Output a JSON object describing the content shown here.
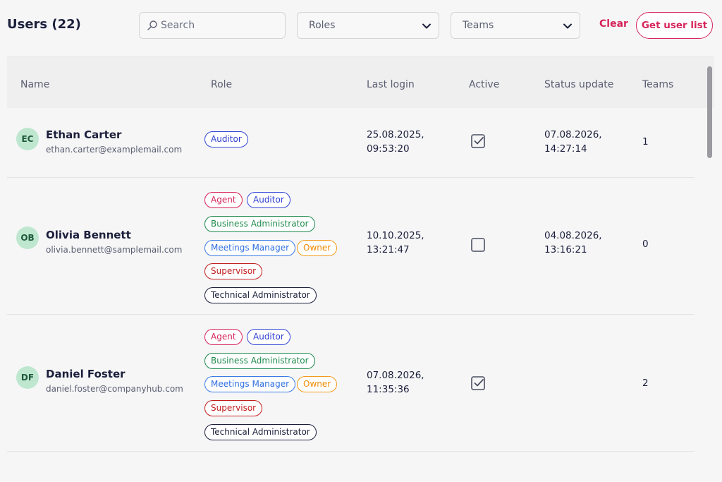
{
  "header": {
    "title": "Users (22)",
    "search_placeholder": "Search",
    "roles_filter": "Roles",
    "teams_filter": "Teams",
    "clear_label": "Clear",
    "get_list_label": "Get user list"
  },
  "table": {
    "columns": [
      "Name",
      "Role",
      "Last login",
      "Active",
      "Status update",
      "Teams"
    ],
    "rows": [
      {
        "initials": "EC",
        "name": "Ethan Carter",
        "email": "ethan.carter@examplemail.com",
        "roles": [
          "Auditor"
        ],
        "last_login_date": "25.08.2025,",
        "last_login_time": "09:53:20",
        "active": true,
        "status_date": "07.08.2026,",
        "status_time": "14:27:14",
        "teams": "1"
      },
      {
        "initials": "OB",
        "name": "Olivia Bennett",
        "email": "olivia.bennett@samplemail.com",
        "roles": [
          "Agent",
          "Auditor",
          "Business Administrator",
          "Meetings Manager",
          "Owner",
          "Supervisor",
          "Technical Administrator"
        ],
        "last_login_date": "10.10.2025,",
        "last_login_time": "13:21:47",
        "active": false,
        "status_date": "04.08.2026,",
        "status_time": "13:16:21",
        "teams": "0"
      },
      {
        "initials": "DF",
        "name": "Daniel Foster",
        "email": "daniel.foster@companyhub.com",
        "roles": [
          "Agent",
          "Auditor",
          "Business Administrator",
          "Meetings Manager",
          "Owner",
          "Supervisor",
          "Technical Administrator"
        ],
        "last_login_date": "07.08.2026,",
        "last_login_time": "11:35:36",
        "active": true,
        "status_date": "",
        "status_time": "",
        "teams": "2"
      }
    ]
  },
  "colors": {
    "accent": "#d6245a",
    "avatar_bg": "#bfe7cf"
  },
  "icons": {
    "search": "search-icon",
    "chevron": "chevron-down-icon",
    "checked": "checkbox-checked-icon",
    "unchecked": "checkbox-unchecked-icon"
  }
}
